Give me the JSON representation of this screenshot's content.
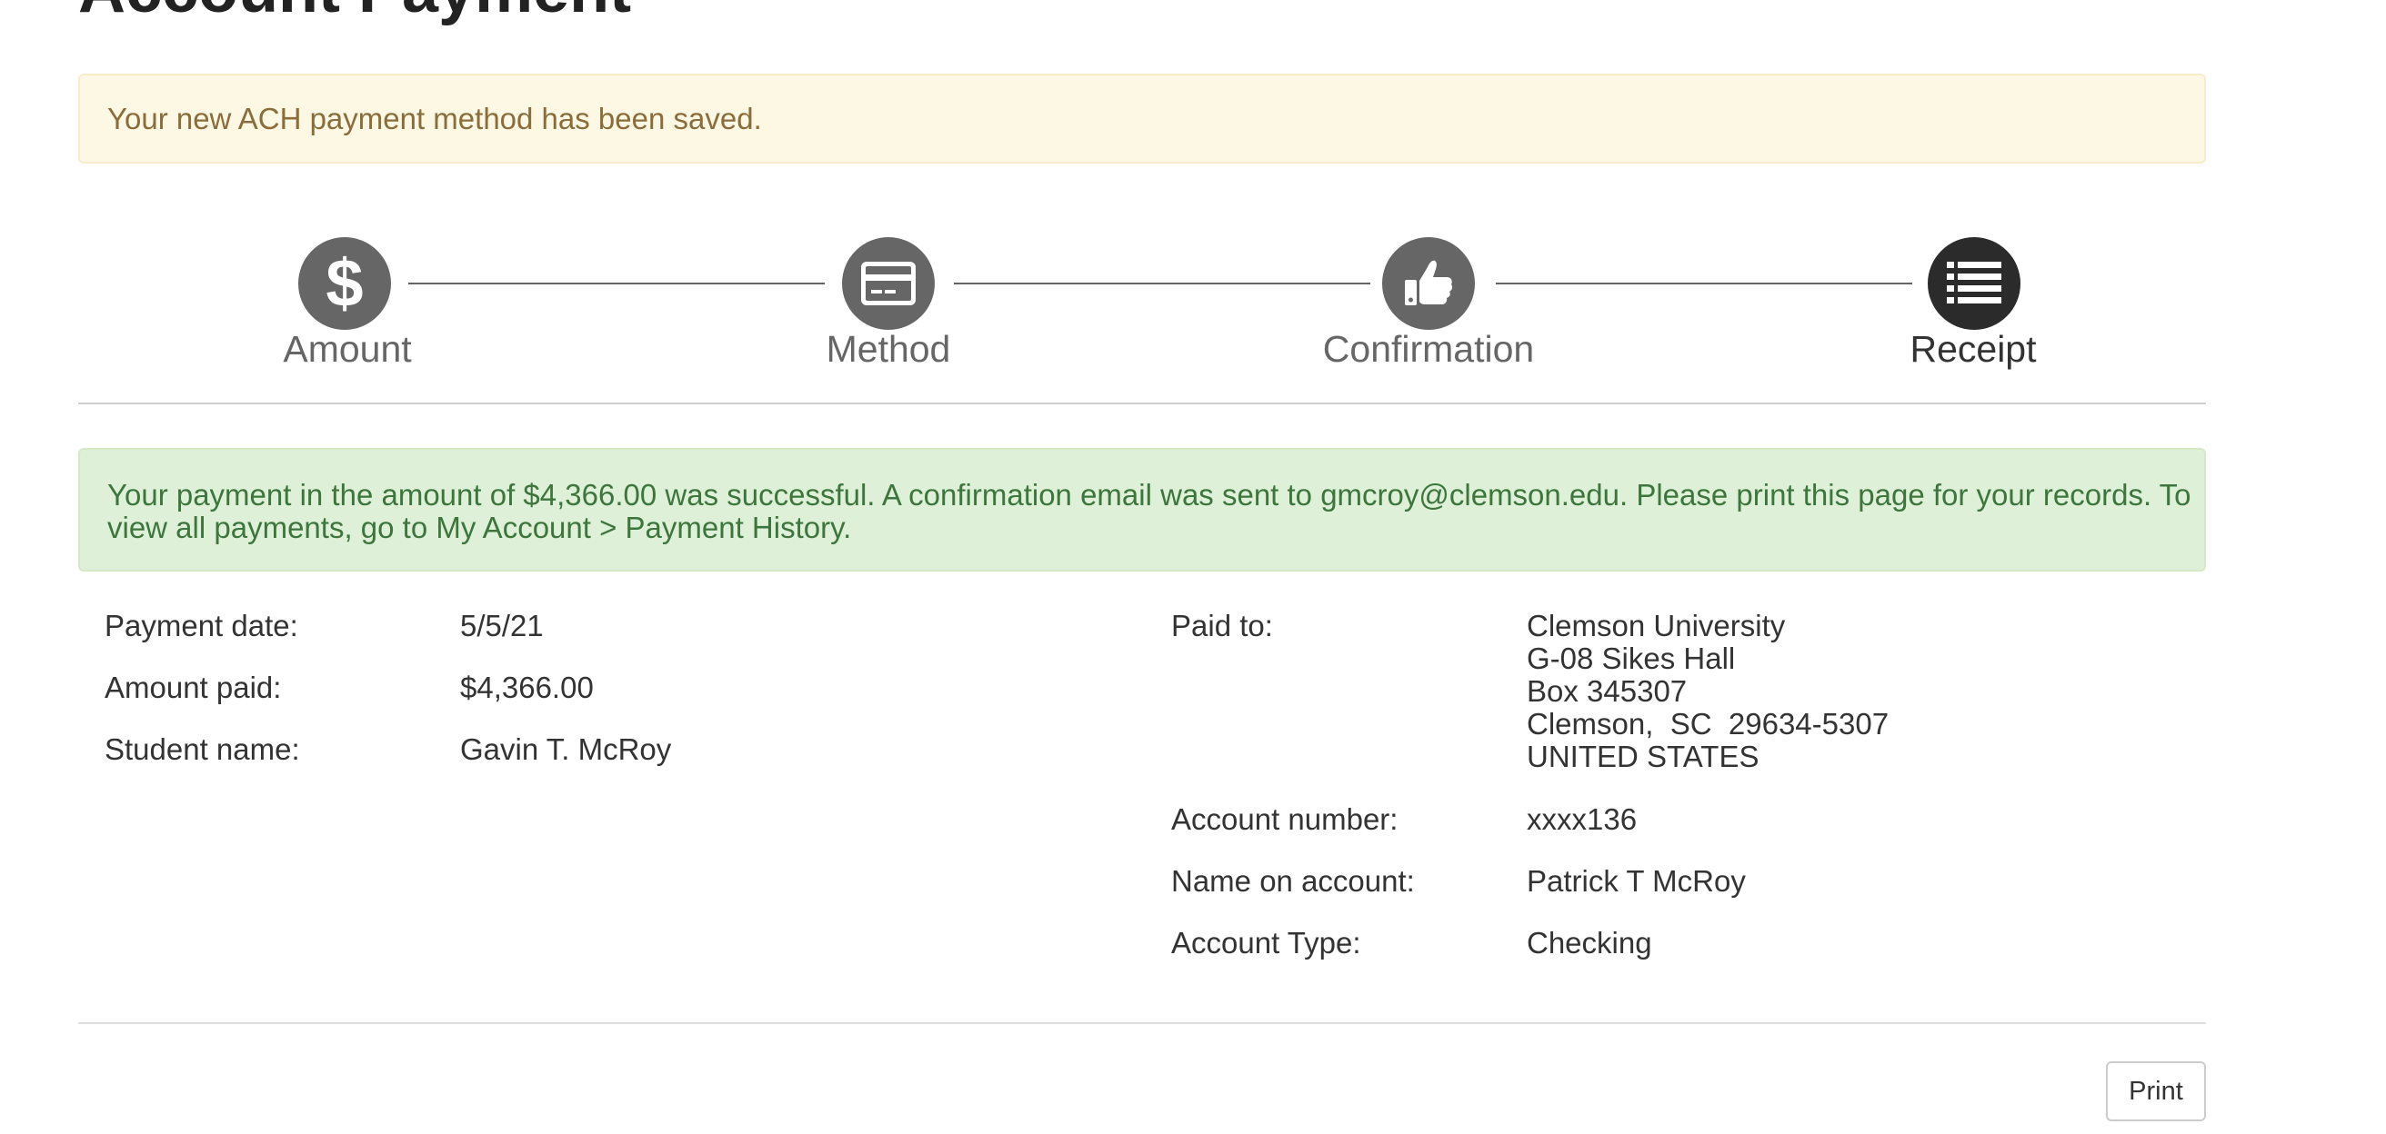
{
  "page": {
    "title": "Account Payment"
  },
  "alerts": {
    "saved_message": "Your new ACH payment method has been saved.",
    "success_message_line1": "Your payment in the amount of $4,366.00 was successful.  A confirmation email was sent to gmcroy@clemson.edu.  Please print this page for your records. To",
    "success_message_line2": "view all payments, go to My Account > Payment History."
  },
  "steps": [
    {
      "label": "Amount",
      "icon": "dollar-icon",
      "active": false
    },
    {
      "label": "Method",
      "icon": "credit-card-icon",
      "active": false
    },
    {
      "label": "Confirmation",
      "icon": "thumbs-up-icon",
      "active": false
    },
    {
      "label": "Receipt",
      "icon": "list-icon",
      "active": true
    }
  ],
  "payment_details": {
    "payment_date_label": "Payment date:",
    "payment_date": "5/5/21",
    "amount_paid_label": "Amount paid:",
    "amount_paid": "$4,366.00",
    "student_name_label": "Student name:",
    "student_name": "Gavin T. McRoy"
  },
  "payee_details": {
    "paid_to_label": "Paid to:",
    "paid_to_lines": [
      "Clemson University",
      "G-08 Sikes Hall",
      "Box 345307",
      "Clemson,  SC  29634-5307",
      "UNITED STATES"
    ],
    "account_number_label": "Account number:",
    "account_number": "xxxx136",
    "name_on_account_label": "Name on account:",
    "name_on_account": "Patrick T McRoy",
    "account_type_label": "Account Type:",
    "account_type": "Checking"
  },
  "actions": {
    "print_label": "Print"
  },
  "colors": {
    "step_inactive": "#666666",
    "step_active": "#2b2b2b",
    "warning_bg": "#fcf8e3",
    "warning_text": "#8a6d3b",
    "success_bg": "#dff0d8",
    "success_text": "#3c763d"
  }
}
